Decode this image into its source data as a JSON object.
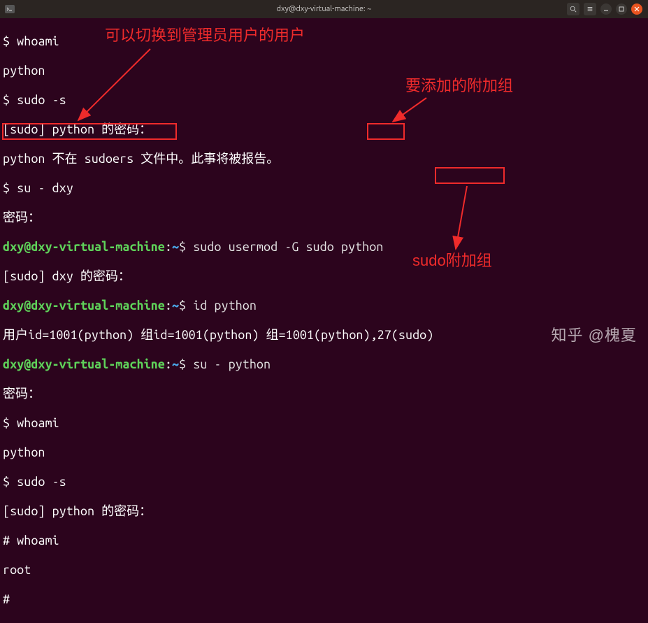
{
  "window": {
    "title": "dxy@dxy-virtual-machine: ~"
  },
  "term": {
    "l01": "$ whoami",
    "l02": "python",
    "l03": "$ sudo -s",
    "l04": "[sudo] python 的密码：",
    "l05": "python 不在 sudoers 文件中。此事将被报告。",
    "l06": "$ su - dxy",
    "l07": "密码：",
    "p1_user": "dxy@dxy-virtual-machine",
    "p1_sep": ":",
    "p1_path": "~",
    "p1_cmd": "$ sudo usermod -G sudo python",
    "l09": "[sudo] dxy 的密码：",
    "p2_cmd": "$ id python",
    "l11": "用户id=1001(python) 组id=1001(python) 组=1001(python),27(sudo)",
    "p3_cmd": "$ su - python",
    "l13": "密码：",
    "l14": "$ whoami",
    "l15": "python",
    "l16": "$ sudo -s",
    "l17": "[sudo] python 的密码：",
    "l18": "# whoami",
    "l19": "root",
    "l20": "# "
  },
  "annotations": {
    "switch_user": "可以切换到管理员用户的用户",
    "add_group": "要添加的附加组",
    "sudo_group": "sudo附加组"
  },
  "watermark": "知乎 @槐夏"
}
